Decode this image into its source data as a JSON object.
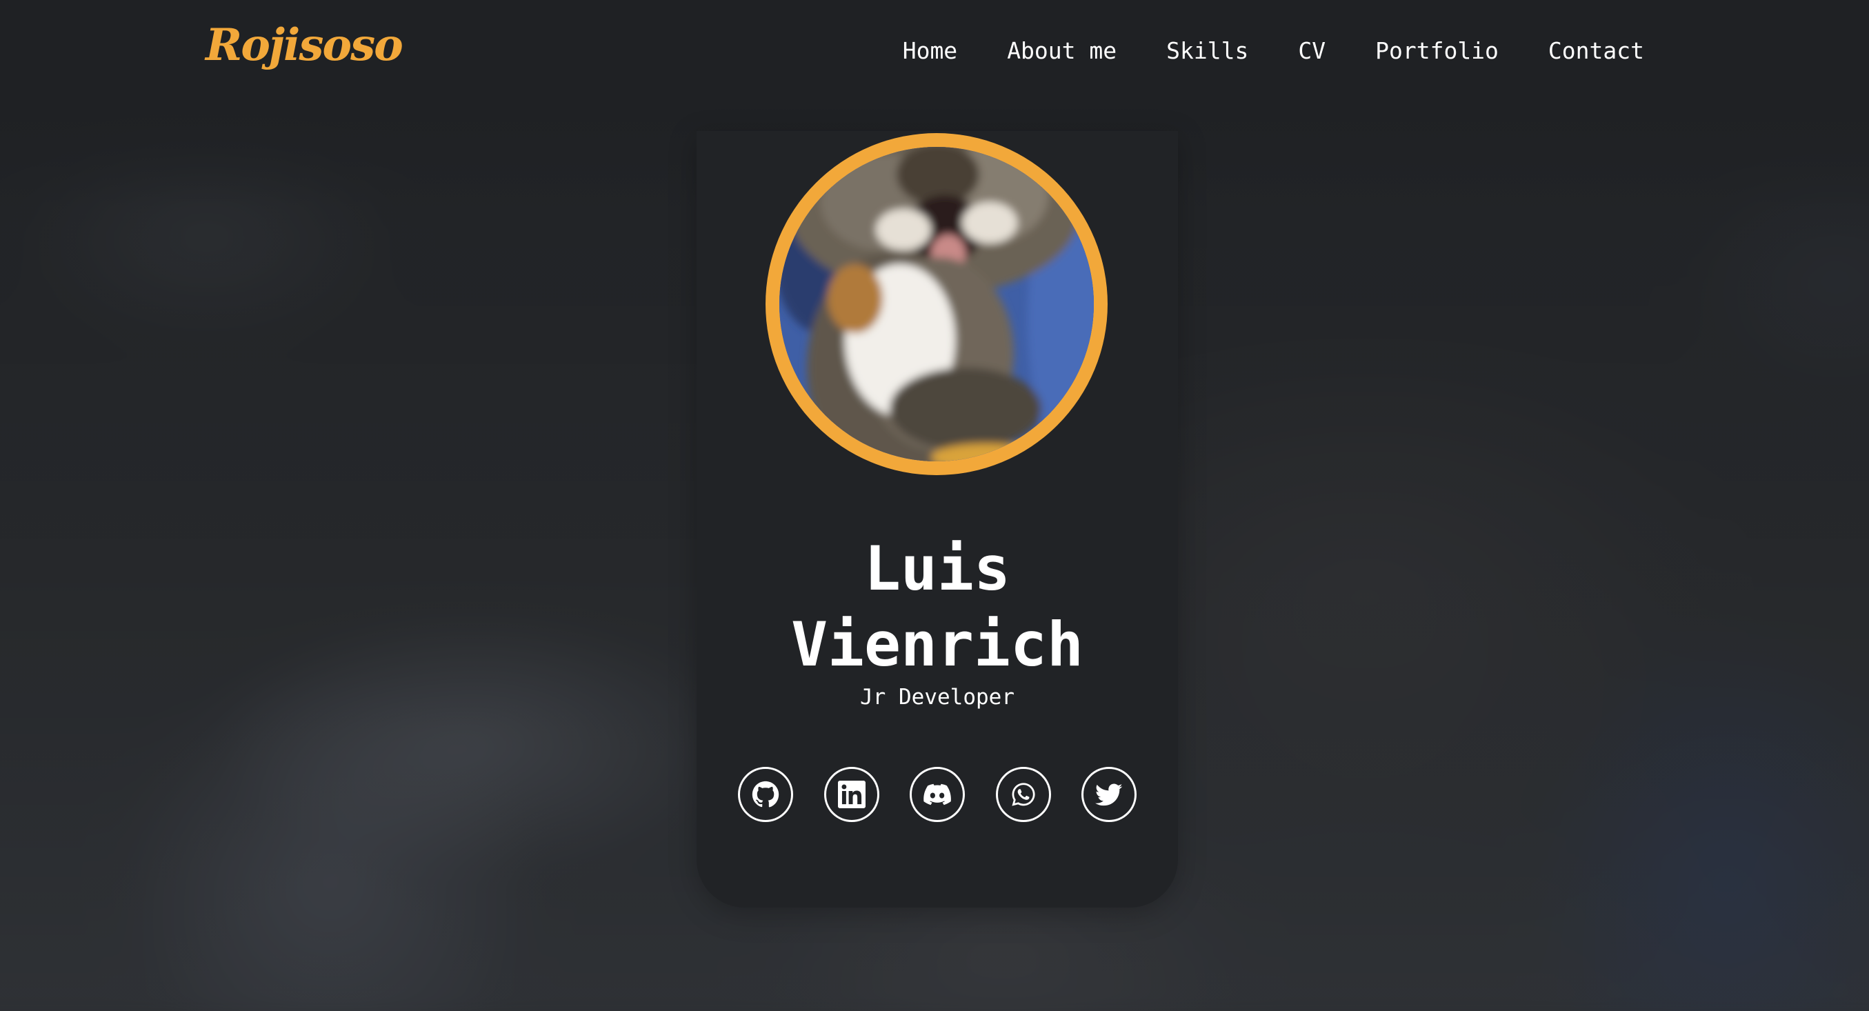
{
  "header": {
    "logo": "Rojisoso",
    "nav": [
      "Home",
      "About me",
      "Skills",
      "CV",
      "Portfolio",
      "Contact"
    ]
  },
  "profile": {
    "name_line1": "Luis",
    "name_line2": "Vienrich",
    "role": "Jr Developer",
    "avatar_alt": "laughing cat photo"
  },
  "socials": [
    {
      "icon": "github-icon"
    },
    {
      "icon": "linkedin-icon"
    },
    {
      "icon": "discord-icon"
    },
    {
      "icon": "whatsapp-icon"
    },
    {
      "icon": "twitter-icon"
    }
  ],
  "colors": {
    "accent": "#f2a83a",
    "card": "#212326",
    "background": "#1f2124",
    "text": "#ffffff"
  }
}
